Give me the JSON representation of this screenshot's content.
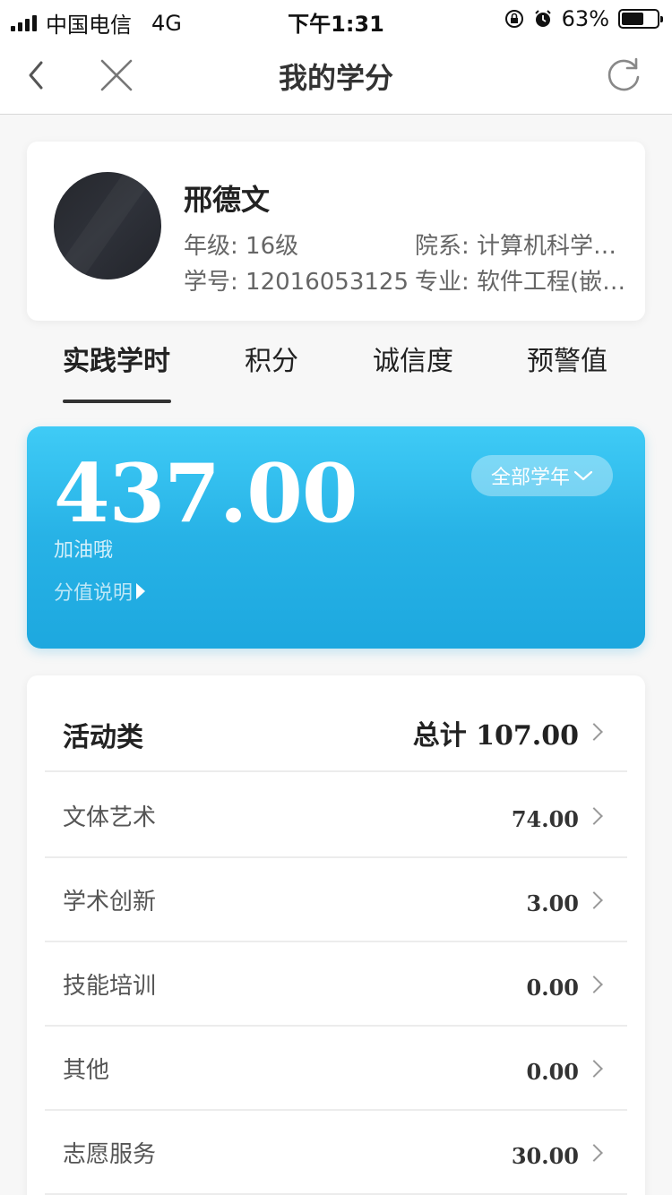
{
  "status_bar": {
    "carrier": "中国电信",
    "network": "4G",
    "time": "下午1:31",
    "battery": "63%",
    "battery_level": 0.63
  },
  "nav": {
    "title": "我的学分"
  },
  "profile": {
    "name": "邢德文",
    "grade": "年级: 16级",
    "department": "院系: 计算机科学与技术学院",
    "student_id": "学号: 12016053125",
    "major": "专业: 软件工程(嵌入式)"
  },
  "tabs": [
    "实践学时",
    "积分",
    "诚信度",
    "预警值"
  ],
  "active_tab": 0,
  "score": {
    "value": "437.00",
    "subtitle": "加油哦",
    "explain_link": "分值说明",
    "year_filter": "全部学年"
  },
  "activity": {
    "title": "活动类",
    "total_label": "总计",
    "total_value": "107.00",
    "items": [
      {
        "label": "文体艺术",
        "value": "74.00"
      },
      {
        "label": "学术创新",
        "value": "3.00"
      },
      {
        "label": "技能培训",
        "value": "0.00"
      },
      {
        "label": "其他",
        "value": "0.00"
      },
      {
        "label": "志愿服务",
        "value": "30.00"
      }
    ]
  },
  "colors": {
    "accent": "#27b2e6",
    "background": "#f7f7f7"
  }
}
